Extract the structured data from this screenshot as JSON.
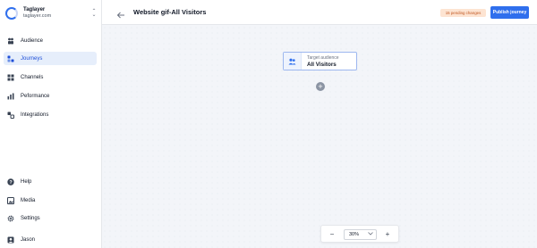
{
  "workspace": {
    "name": "Taglayer",
    "domain": "taglayer.com",
    "switch_icon": "chevron-updown-icon"
  },
  "sidebar": {
    "items": [
      {
        "label": "Audience",
        "icon": "audience-icon",
        "active": false
      },
      {
        "label": "Journeys",
        "icon": "journeys-icon",
        "active": true
      },
      {
        "label": "Channels",
        "icon": "channels-icon",
        "active": false
      },
      {
        "label": "Peformance",
        "icon": "performance-icon",
        "active": false
      },
      {
        "label": "Integrations",
        "icon": "integrations-icon",
        "active": false
      }
    ],
    "bottom_items": [
      {
        "label": "Help",
        "icon": "help-icon"
      },
      {
        "label": "Media",
        "icon": "media-icon"
      },
      {
        "label": "Settings",
        "icon": "settings-icon"
      },
      {
        "label": "Jason",
        "icon": "user-icon"
      }
    ]
  },
  "header": {
    "title": "Website gif-All Visitors",
    "pending": "15 pending changes",
    "publish_label": "Publish journey"
  },
  "canvas": {
    "node": {
      "label": "Target audience",
      "value": "All Visitors"
    },
    "add_label": "+"
  },
  "zoom": {
    "minus": "−",
    "value": "30%",
    "plus": "+"
  },
  "colors": {
    "accent": "#2f6fed",
    "active_bg": "#e6eefb",
    "pending_bg": "#fde4d2",
    "pending_text": "#c05621"
  }
}
